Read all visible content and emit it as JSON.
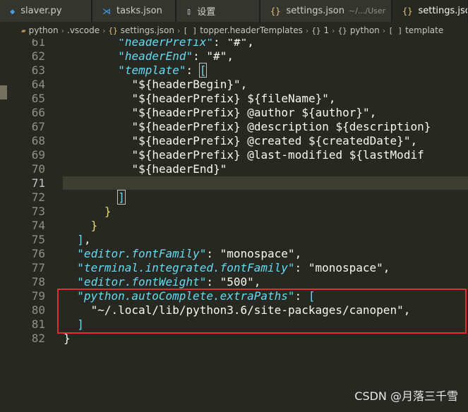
{
  "tabs": [
    {
      "label": "slaver.py",
      "icon": "python-icon",
      "icon_color": "#4e9ad6"
    },
    {
      "label": "tasks.json",
      "icon": "vscode-icon",
      "icon_color": "#3ea6ff"
    },
    {
      "label": "设置",
      "icon": "file-icon",
      "icon_color": "#d4d4d4"
    },
    {
      "label": "settings.json",
      "sub": "~/.../User",
      "icon": "json-icon",
      "icon_color": "#e5c07b"
    },
    {
      "label": "settings.json",
      "icon": "json-icon",
      "icon_color": "#e5c07b",
      "active": true
    }
  ],
  "breadcrumb": [
    {
      "label": "python",
      "icon": "folder-icon"
    },
    {
      "label": ".vscode"
    },
    {
      "label": "settings.json",
      "icon": "json-icon"
    },
    {
      "label": "topper.headerTemplates",
      "icon": "array-icon"
    },
    {
      "label": "1",
      "icon": "object-icon"
    },
    {
      "label": "python",
      "icon": "object-icon"
    },
    {
      "label": "template",
      "icon": "array-icon"
    }
  ],
  "lines": [
    {
      "n": "61",
      "indent": 4,
      "tokens": [
        [
          "k",
          "\"headerPrefix\""
        ],
        [
          "p",
          ": "
        ],
        [
          "w",
          "\"#\""
        ],
        [
          "p",
          ","
        ]
      ]
    },
    {
      "n": "62",
      "indent": 4,
      "tokens": [
        [
          "k",
          "\"headerEnd\""
        ],
        [
          "p",
          ": "
        ],
        [
          "w",
          "\"#\""
        ],
        [
          "p",
          ","
        ]
      ]
    },
    {
      "n": "63",
      "indent": 4,
      "tokens": [
        [
          "k",
          "\"template\""
        ],
        [
          "p",
          ": "
        ],
        [
          "bm",
          "["
        ]
      ]
    },
    {
      "n": "64",
      "indent": 5,
      "tokens": [
        [
          "w",
          "\"${headerBegin}\","
        ]
      ]
    },
    {
      "n": "65",
      "indent": 5,
      "tokens": [
        [
          "w",
          "\"${headerPrefix} ${fileName}\","
        ]
      ]
    },
    {
      "n": "66",
      "indent": 5,
      "tokens": [
        [
          "w",
          "\"${headerPrefix} @author ${author}\","
        ]
      ]
    },
    {
      "n": "67",
      "indent": 5,
      "tokens": [
        [
          "w",
          "\"${headerPrefix} @description ${description}"
        ]
      ]
    },
    {
      "n": "68",
      "indent": 5,
      "tokens": [
        [
          "w",
          "\"${headerPrefix} @created ${createdDate}\","
        ]
      ]
    },
    {
      "n": "69",
      "indent": 5,
      "tokens": [
        [
          "w",
          "\"${headerPrefix} @last-modified ${lastModif"
        ]
      ]
    },
    {
      "n": "70",
      "indent": 5,
      "tokens": [
        [
          "w",
          "\"${headerEnd}\""
        ]
      ]
    },
    {
      "n": "71",
      "indent": 0,
      "tokens": [],
      "current": true
    },
    {
      "n": "72",
      "indent": 4,
      "tokens": [
        [
          "bm",
          "]"
        ]
      ]
    },
    {
      "n": "73",
      "indent": 3,
      "tokens": [
        [
          "s",
          "}"
        ]
      ]
    },
    {
      "n": "74",
      "indent": 2,
      "tokens": [
        [
          "s",
          "}"
        ]
      ]
    },
    {
      "n": "75",
      "indent": 1,
      "tokens": [
        [
          "b",
          "]"
        ],
        [
          "p",
          ","
        ]
      ]
    },
    {
      "n": "76",
      "indent": 1,
      "tokens": [
        [
          "k",
          "\"editor.fontFamily\""
        ],
        [
          "p",
          ": "
        ],
        [
          "w",
          "\"monospace\""
        ],
        [
          "p",
          ","
        ]
      ]
    },
    {
      "n": "77",
      "indent": 1,
      "tokens": [
        [
          "k",
          "\"terminal.integrated.fontFamily\""
        ],
        [
          "p",
          ": "
        ],
        [
          "w",
          "\"monospace\""
        ],
        [
          "p",
          ","
        ]
      ]
    },
    {
      "n": "78",
      "indent": 1,
      "tokens": [
        [
          "k",
          "\"editor.fontWeight\""
        ],
        [
          "p",
          ": "
        ],
        [
          "w",
          "\"500\""
        ],
        [
          "p",
          ","
        ]
      ]
    },
    {
      "n": "79",
      "indent": 1,
      "tokens": [
        [
          "k",
          "\"python.autoComplete.extraPaths\""
        ],
        [
          "p",
          ": "
        ],
        [
          "b",
          "["
        ]
      ]
    },
    {
      "n": "80",
      "indent": 2,
      "tokens": [
        [
          "w",
          "\"~/.local/lib/python3.6/site-packages/canopen\""
        ],
        [
          "p",
          ","
        ]
      ]
    },
    {
      "n": "81",
      "indent": 1,
      "tokens": [
        [
          "b",
          "]"
        ]
      ]
    },
    {
      "n": "82",
      "indent": 0,
      "tokens": [
        [
          "p",
          "}"
        ]
      ]
    }
  ],
  "watermark": "CSDN @月落三千雪",
  "colors": {
    "background": "#272822",
    "key": "#66d9ef",
    "string": "#f8f8f2",
    "highlight_box": "#e02d2d"
  }
}
